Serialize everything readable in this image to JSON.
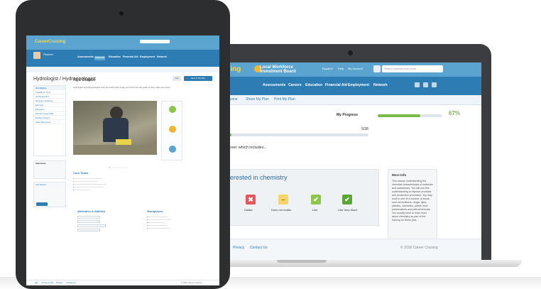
{
  "laptop": {
    "brand_partial": "ising",
    "lwib": "Local Workforce Investment Board",
    "top_links": [
      "Español",
      "Help",
      "My Account"
    ],
    "search_placeholder": "Search careers and more",
    "nav": [
      "Assessments",
      "Careers",
      "Education",
      "Financial Aid",
      "Employment",
      "Network"
    ],
    "subnav": [
      "Resume",
      "Share My Plan",
      "Print My Plan"
    ],
    "progress_label": "My Progress",
    "progress_pct_text": "67%",
    "progress_value": 0.67,
    "count_text": "5/38",
    "prompt": "a career which includes...",
    "question": "Interested in chemistry",
    "ratings": [
      {
        "label": "Dislike",
        "color": "#e4575b",
        "glyph": "✖"
      },
      {
        "label": "Does not matter",
        "color": "#f4d46b",
        "glyph": "–"
      },
      {
        "label": "Like",
        "color": "#8ec64b",
        "glyph": "✔"
      },
      {
        "label": "Like Very Much",
        "color": "#5aa832",
        "glyph": "✔"
      }
    ],
    "rating_left_partial": "uch",
    "info_title": "More Info",
    "info_text": "This means understanding the chemical characteristics of materials and substances. You will use this understanding to improve products and production processes. You may work in one of a number of areas, such as fertilizers, drugs, dyes, plastics, cosmetics, paints, food preservatives and petrochemicals. You usually have to learn more about chemistry as part of the training for these jobs.",
    "footer_links": [
      "Privacy",
      "Contact Us"
    ],
    "copyright": "© 2016 Career Cruising"
  },
  "tablet": {
    "brand": "CareerCruising",
    "user": "Planner",
    "nav": [
      "Assessments",
      "Careers",
      "Education",
      "Financial Aid",
      "Employment",
      "Network"
    ],
    "title": "Hydrologist / Hydrogeologist",
    "buttons": [
      "Add",
      "Save to My Plan"
    ],
    "side_items": [
      "At a Glance",
      "Suitable for You?",
      "Job Description",
      "Working Conditions",
      "Earnings",
      "Education",
      "Sample Career Path",
      "Related Careers",
      "Other Resources"
    ],
    "side_box_title": "Interviews",
    "side_box2_title": "Job Search",
    "glance_title": "At a Glance",
    "glance_text": "Hydrologists and hydrogeologists study the world's water supply and ensure the safe quality of rivers, lakes and oceans",
    "core_tasks_title": "Core Tasks",
    "skills_title": "Attributes & Abilities",
    "workplace_title": "Workplaces",
    "footer_links": [
      "Site",
      "Terms of Use",
      "Privacy",
      "Contact Us"
    ],
    "copyright": "© 2016 Career Cruising"
  },
  "colors": {
    "header": "#5ba4d0",
    "nav": "#2e7cb4",
    "accent": "#7ab94a",
    "brand": "#f7d54a"
  }
}
